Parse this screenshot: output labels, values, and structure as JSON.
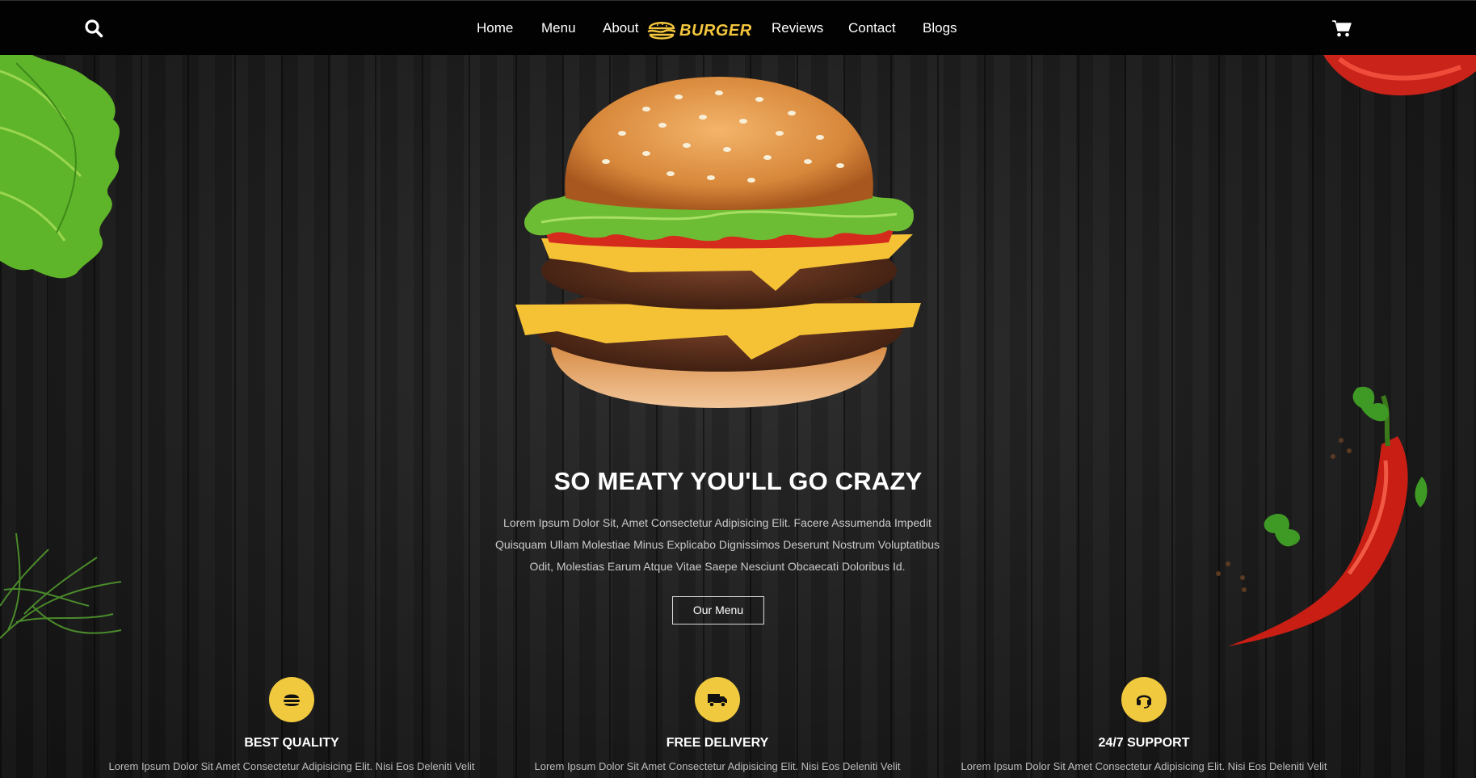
{
  "header": {
    "nav_left": [
      "Home",
      "Menu",
      "About"
    ],
    "logo_text": "BURGER",
    "nav_right": [
      "Reviews",
      "Contact",
      "Blogs"
    ],
    "icons": {
      "search": "search-icon",
      "cart": "cart-icon"
    }
  },
  "hero": {
    "title": "SO MEATY YOU'LL GO CRAZY",
    "text_lines": [
      "Lorem Ipsum Dolor Sit, Amet Consectetur Adipisicing Elit. Facere Assumenda Impedit",
      "Quisquam Ullam Molestiae Minus Explicabo Dignissimos Deserunt Nostrum Voluptatibus",
      "Odit, Molestias Earum Atque Vitae Saepe Nesciunt Obcaecati Doloribus Id."
    ],
    "button_label": "Our Menu"
  },
  "features": [
    {
      "icon": "hamburger-icon",
      "title": "BEST QUALITY",
      "text": "Lorem Ipsum Dolor Sit Amet Consectetur Adipisicing Elit. Nisi Eos Deleniti Velit"
    },
    {
      "icon": "truck-icon",
      "title": "FREE DELIVERY",
      "text": "Lorem Ipsum Dolor Sit Amet Consectetur Adipisicing Elit. Nisi Eos Deleniti Velit"
    },
    {
      "icon": "headset-icon",
      "title": "24/7 SUPPORT",
      "text": "Lorem Ipsum Dolor Sit Amet Consectetur Adipisicing Elit. Nisi Eos Deleniti Velit"
    }
  ],
  "colors": {
    "accent": "#f0c93e",
    "header_bg": "#020202",
    "page_bg": "#1a1a1a"
  }
}
